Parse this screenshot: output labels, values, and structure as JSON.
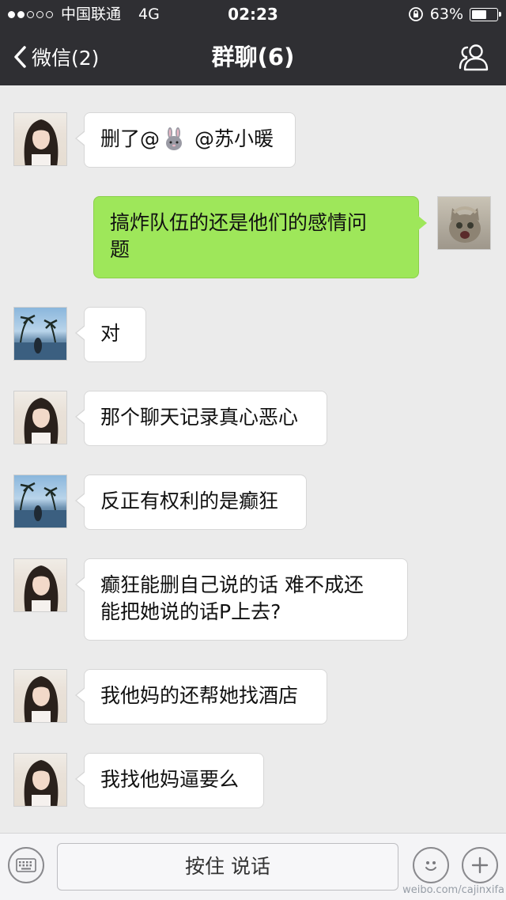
{
  "status_bar": {
    "carrier": "中国联通",
    "network": "4G",
    "time": "02:23",
    "battery": "63%",
    "battery_level": 0.63
  },
  "nav": {
    "back_label": "微信(2)",
    "title": "群聊(6)",
    "members_icon": "group-members-icon"
  },
  "messages": [
    {
      "side": "left",
      "avatar": "girl",
      "text_before": "删了@",
      "emoji": "rabbit-emoji",
      "text_after": " @苏小暖"
    },
    {
      "side": "right",
      "avatar": "cat",
      "text": "搞炸队伍的还是他们的感情问\n题"
    },
    {
      "side": "left",
      "avatar": "beach",
      "text": "对"
    },
    {
      "side": "left",
      "avatar": "girl",
      "text": "那个聊天记录真心恶心"
    },
    {
      "side": "left",
      "avatar": "beach",
      "text": "反正有权利的是癫狂"
    },
    {
      "side": "left",
      "avatar": "girl",
      "text": "癫狂能删自己说的话 难不成还\n能把她说的话P上去?"
    },
    {
      "side": "left",
      "avatar": "girl",
      "text": "我他妈的还帮她找酒店"
    },
    {
      "side": "left",
      "avatar": "girl",
      "text": "我找他妈逼要么"
    }
  ],
  "input_bar": {
    "hold_to_talk": "按住 说话",
    "keyboard_icon": "keyboard-icon",
    "emoji_icon": "smiley-icon",
    "plus_icon": "plus-icon"
  },
  "watermark": {
    "line1": "weibo.com/cajinxifa"
  }
}
